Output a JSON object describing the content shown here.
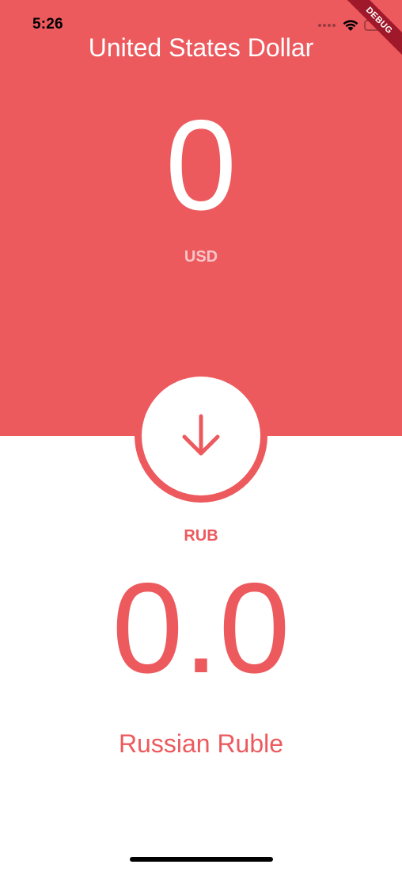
{
  "status_bar": {
    "time": "5:26",
    "icons": [
      "signal-dots-icon",
      "wifi-icon",
      "battery-icon"
    ]
  },
  "debug_banner": {
    "label": "DEBUG"
  },
  "from_currency": {
    "name": "United States Dollar",
    "amount": "0",
    "code": "USD"
  },
  "swap_button": {
    "icon": "arrow-down-icon"
  },
  "to_currency": {
    "code": "RUB",
    "amount": "0.0",
    "name": "Russian Ruble"
  },
  "colors": {
    "accent": "#ec5a5e",
    "background": "#ffffff",
    "text_light": "#ffffff",
    "debug_ribbon": "#a0192a"
  }
}
